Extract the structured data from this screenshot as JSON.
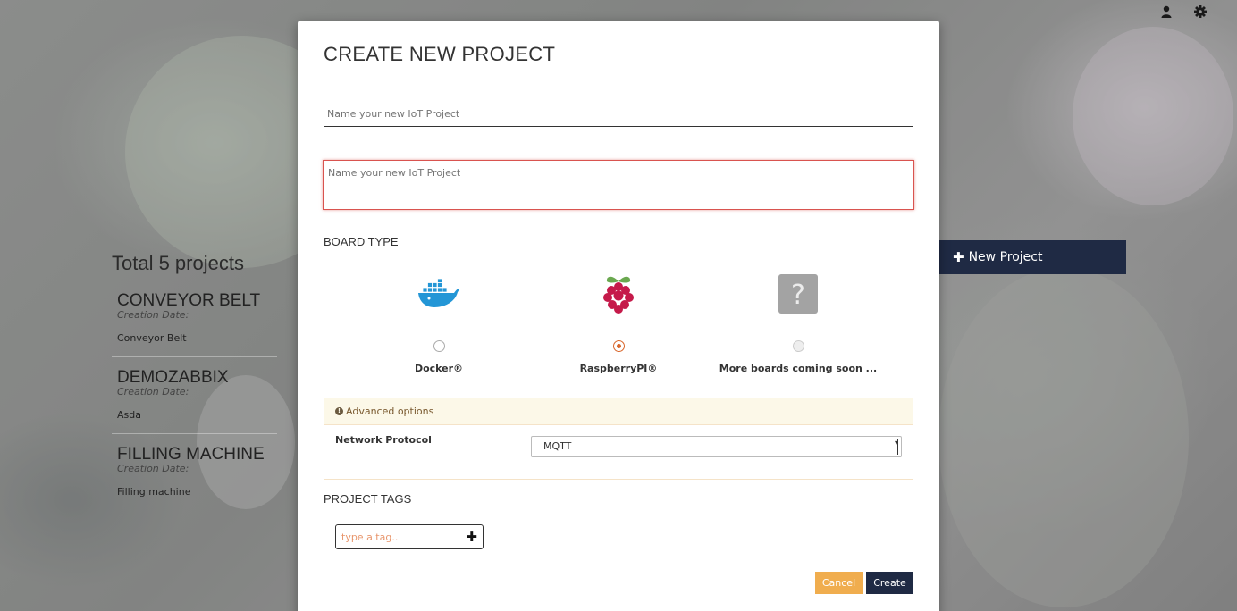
{
  "background": {
    "total_projects": "Total 5 projects",
    "projects": [
      {
        "name": "CONVEYOR BELT",
        "date_label": "Creation Date:",
        "description": "Conveyor Belt"
      },
      {
        "name": "DEMOZABBIX",
        "date_label": "Creation Date:",
        "description": "Asda"
      },
      {
        "name": "FILLING MACHINE",
        "date_label": "Creation Date:",
        "description": "Filling machine"
      }
    ],
    "new_project_button": "New Project",
    "top_icons": [
      "user-icon",
      "gear-icon"
    ]
  },
  "modal": {
    "title": "CREATE NEW PROJECT",
    "name_placeholder": "Name your new IoT Project",
    "description_placeholder": "Name your new IoT Project",
    "board_type_label": "BOARD TYPE",
    "boards": [
      {
        "name": "Docker®",
        "icon": "docker-icon",
        "selected": false,
        "disabled": false
      },
      {
        "name": "RaspberryPI®",
        "icon": "raspberry-pi-icon",
        "selected": true,
        "disabled": false
      },
      {
        "name": "More boards coming soon ...",
        "icon": "question-icon",
        "selected": false,
        "disabled": true
      }
    ],
    "advanced": {
      "header": "Advanced options",
      "network_label": "Network Protocol",
      "network_value": "MQTT"
    },
    "tags_label": "PROJECT TAGS",
    "tag_placeholder": "type a tag..",
    "cancel_label": "Cancel",
    "create_label": "Create"
  },
  "colors": {
    "primary": "#1f2a44",
    "warning": "#f0ad4e",
    "error_border": "#d9534f",
    "radio_accent": "#d9662b"
  }
}
